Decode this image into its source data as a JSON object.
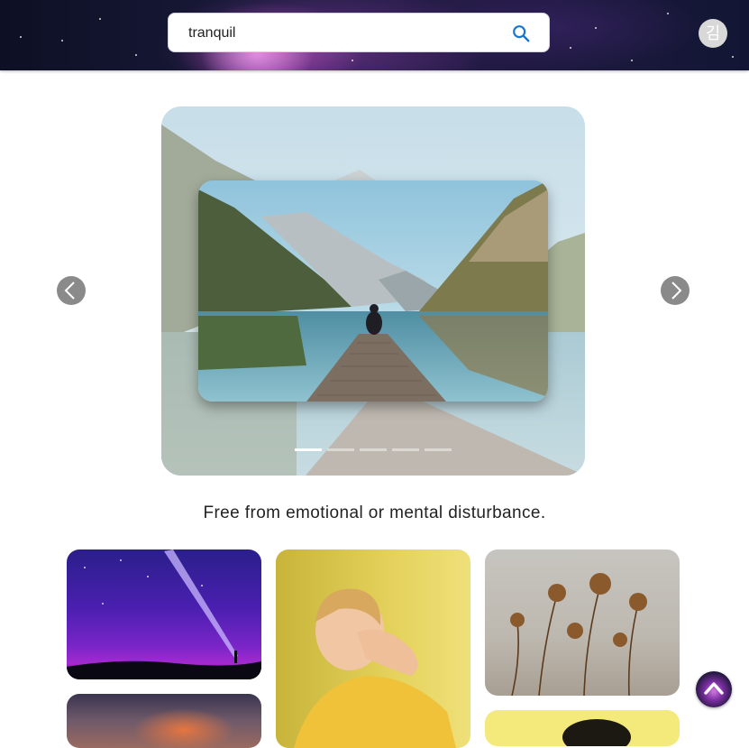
{
  "header": {
    "search": {
      "value": "tranquil",
      "icon": "search-icon"
    },
    "avatar": {
      "initial": "김"
    }
  },
  "carousel": {
    "slides_count": 5,
    "active_index": 0,
    "prev_icon": "chevron-left-icon",
    "next_icon": "chevron-right-icon"
  },
  "caption": "Free from emotional or mental disturbance.",
  "gallery": {
    "tiles": [
      "purple-night-sky-flashlight",
      "sunset-clouds",
      "child-covering-eyes",
      "dried-flowers",
      "yellow-portrait"
    ]
  },
  "scroll_top": {
    "icon": "chevron-up-icon"
  },
  "colors": {
    "accent": "#1976d2",
    "arrow_bg": "#8a8a8a"
  }
}
